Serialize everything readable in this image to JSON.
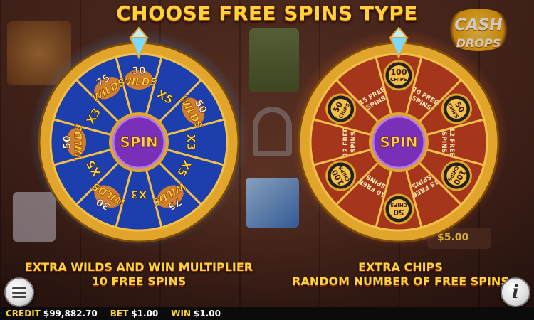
{
  "title": "CHOOSE FREE SPINS TYPE",
  "logo": {
    "line1": "CASH",
    "line2": "DROPS"
  },
  "left_wheel": {
    "center_label": "SPIN",
    "segments": [
      {
        "top": "30",
        "bottom": "WILDS"
      },
      {
        "top": "X5",
        "bottom": ""
      },
      {
        "top": "50",
        "bottom": "WILDS"
      },
      {
        "top": "X3",
        "bottom": ""
      },
      {
        "top": "X5",
        "bottom": ""
      },
      {
        "top": "75",
        "bottom": "WILDS"
      },
      {
        "top": "X3",
        "bottom": ""
      },
      {
        "top": "30",
        "bottom": "WILDS"
      },
      {
        "top": "X5",
        "bottom": ""
      },
      {
        "top": "50",
        "bottom": "WILDS"
      },
      {
        "top": "X3",
        "bottom": ""
      },
      {
        "top": "75",
        "bottom": "WILDS"
      }
    ],
    "caption_line1": "EXTRA WILDS AND WIN MULTIPLIER",
    "caption_line2": "10 FREE SPINS",
    "colors": {
      "face": "#1d3fae",
      "rim": "#e0a52a",
      "glow": "#4aa0ff"
    }
  },
  "right_wheel": {
    "center_label": "SPIN",
    "segments": [
      {
        "chip": "100",
        "sub": "CHIPS"
      },
      {
        "text": "10 FREE SPINS"
      },
      {
        "chip": "50",
        "sub": "CHIPS"
      },
      {
        "text": "12 FREE SPINS"
      },
      {
        "chip": "100",
        "sub": "CHIPS"
      },
      {
        "text": "15 FREE SPINS"
      },
      {
        "chip": "50",
        "sub": "CHIPS"
      },
      {
        "text": "10 FREE SPINS"
      },
      {
        "chip": "100",
        "sub": "CHIPS"
      },
      {
        "text": "12 FREE SPINS"
      },
      {
        "chip": "50",
        "sub": "CHIPS"
      },
      {
        "text": "15 FREE SPINS"
      }
    ],
    "caption_line1": "EXTRA CHIPS",
    "caption_line2": "RANDOM NUMBER OF FREE SPINS",
    "colors": {
      "face": "#a5361b",
      "rim": "#e0a52a",
      "glow": "#ff6a20"
    }
  },
  "background_reel_value": "$5.00",
  "status_bar": {
    "credit_label": "CREDIT",
    "credit_value": "$99,882.70",
    "bet_label": "BET",
    "bet_value": "$1.00",
    "win_label": "WIN",
    "win_value": "$1.00"
  },
  "buttons": {
    "menu_icon": "menu-icon",
    "info_icon": "info-icon",
    "info_glyph": "i"
  }
}
